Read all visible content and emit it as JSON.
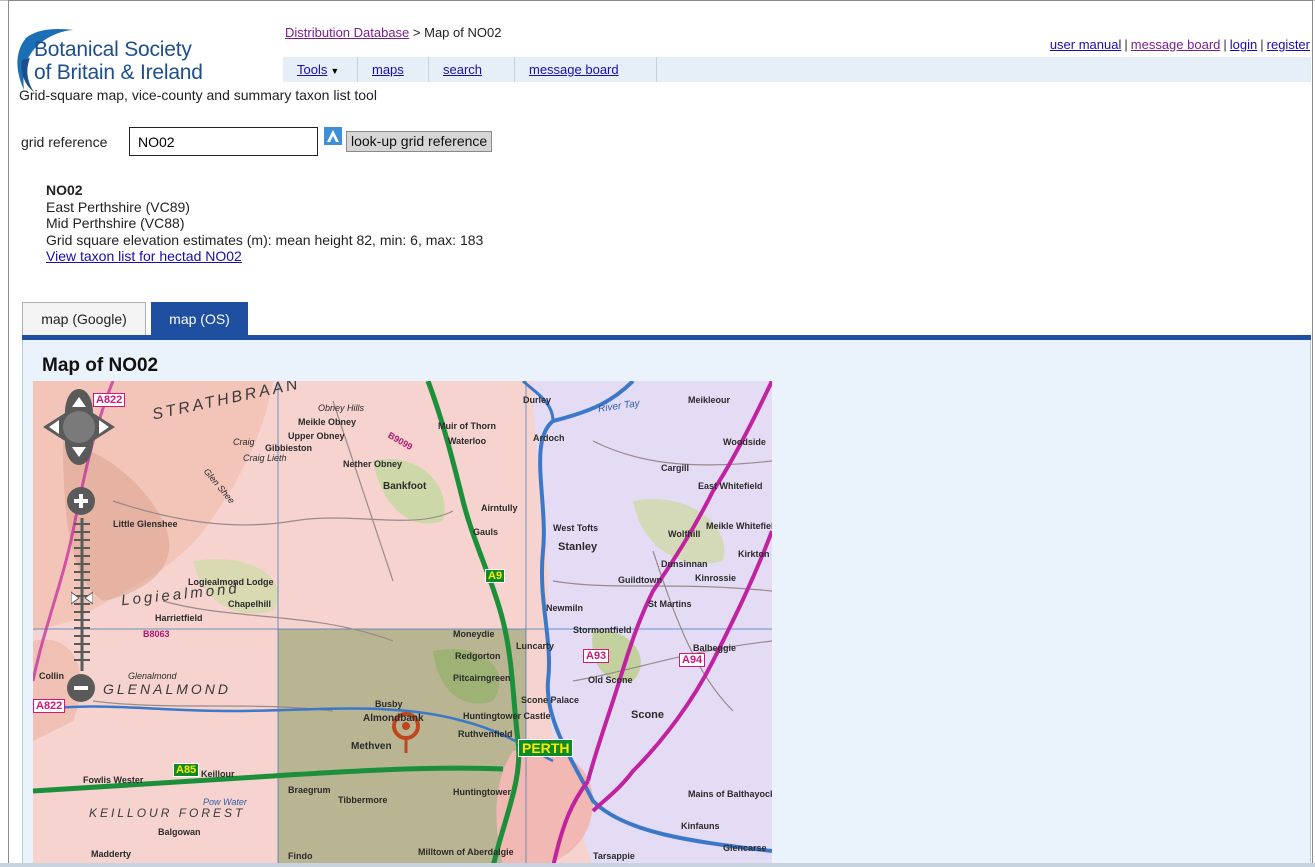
{
  "header": {
    "logo_line1": "Botanical Society",
    "logo_line2": "of Britain & Ireland",
    "breadcrumb_link": "Distribution Database",
    "breadcrumb_rest": " > Map of NO02",
    "tagline": "Grid-square map, vice-county and summary taxon list tool",
    "toplinks": [
      "user manual",
      "message board",
      "login",
      "register"
    ]
  },
  "menu": {
    "tools": "Tools",
    "maps": "maps",
    "search": "search",
    "message_board": "message board"
  },
  "search": {
    "label": "grid reference",
    "value": "NO02",
    "button": "look-up grid reference"
  },
  "info": {
    "square": "NO02",
    "vc1": "East Perthshire (VC89)",
    "vc2": "Mid Perthshire (VC88)",
    "elevation": "Grid square elevation estimates (m): mean height 82, min: 6, max: 183",
    "taxon_link": "View taxon list for hectad NO02"
  },
  "tabs": {
    "google": "map (Google)",
    "os": "map (OS)"
  },
  "map": {
    "title": "Map of NO02",
    "places": [
      "Upper Obney",
      "Meikle Obney",
      "Gibbieston",
      "Muir of Thorn",
      "Waterloo",
      "Nether Obney",
      "Bankfoot",
      "Airntully",
      "Gauls",
      "Cargill",
      "East Whitefield",
      "Woodside",
      "Meikleour",
      "Stanley",
      "West Tofts",
      "Wolfhill",
      "Meikle Whitefield",
      "Dunsinnan",
      "Guildtown",
      "Kinrossie",
      "St Martins",
      "Newmiln",
      "Stormontfield",
      "Balbeggie",
      "Little Glenshee",
      "Logiealmond Lodge",
      "Harrietfield",
      "Chapelhill",
      "Moneydie",
      "Redgorton",
      "Pitcairngreen",
      "Luncarty",
      "Busby",
      "Almondbank",
      "Huntingtower Castle",
      "Ruthvenfield",
      "Methven",
      "Old Scone",
      "Scone",
      "Keillour",
      "Fowlis Wester",
      "Braegrum",
      "Tibbermore",
      "Huntingtower",
      "Mains of Balthayock",
      "Kinfauns",
      "Glencarse",
      "Balgowan",
      "Madderty",
      "Findo",
      "Milltown of Aberdalgie",
      "Tarsappie",
      "Kirkton of Collace",
      "Durley",
      "Ardoch",
      "Obney Hills",
      "Craig Lieth",
      "Glen Shee",
      "Glenalmond",
      "Pow Water",
      "Scone Palace",
      "Craig",
      "Collin"
    ],
    "areas": [
      "STRATHBRAAN",
      "Logiealmond",
      "KEILLOUR FOREST",
      "GLENALMOND"
    ],
    "roads": [
      "A822",
      "A9",
      "A93",
      "A94",
      "A85",
      "A822",
      "B8063",
      "B9099"
    ],
    "city": "PERTH",
    "river": "River Tay"
  },
  "colors": {
    "accent": "#1f4fa0",
    "map_pink": "#f6d6d2",
    "map_lilac": "#e6dcf6"
  }
}
